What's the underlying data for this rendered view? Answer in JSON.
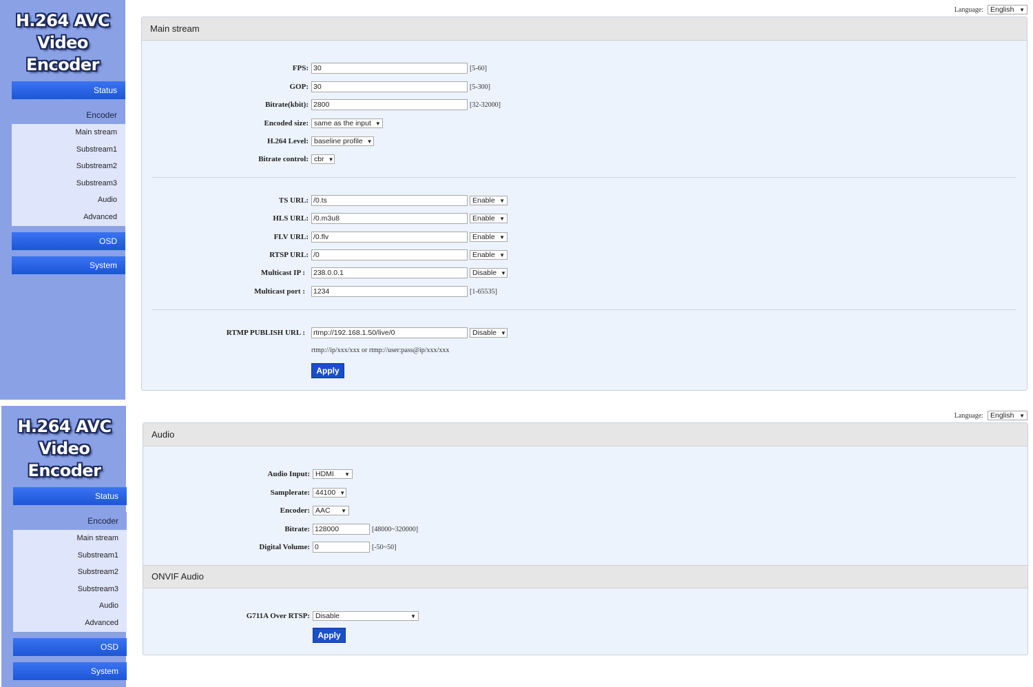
{
  "logo": {
    "line1": "H.264 AVC",
    "line2": "Video Encoder"
  },
  "sidebar": {
    "status": "Status",
    "encoder": "Encoder",
    "items": [
      "Main stream",
      "Substream1",
      "Substream2",
      "Substream3",
      "Audio",
      "Advanced"
    ],
    "osd": "OSD",
    "system": "System"
  },
  "language": {
    "label": "Language:",
    "value": "English"
  },
  "main_stream": {
    "title": "Main stream",
    "fps": {
      "label": "FPS:",
      "value": "30",
      "range": "[5-60]"
    },
    "gop": {
      "label": "GOP:",
      "value": "30",
      "range": "[5-300]"
    },
    "bitrate": {
      "label": "Bitrate(kbit):",
      "value": "2800",
      "range": "[32-32000]"
    },
    "encoded_size": {
      "label": "Encoded size:",
      "value": "same as the input"
    },
    "h264_level": {
      "label": "H.264 Level:",
      "value": "baseline profile"
    },
    "bitrate_control": {
      "label": "Bitrate control:",
      "value": "cbr"
    },
    "ts_url": {
      "label": "TS URL:",
      "value": "/0.ts",
      "state": "Enable"
    },
    "hls_url": {
      "label": "HLS URL:",
      "value": "/0.m3u8",
      "state": "Enable"
    },
    "flv_url": {
      "label": "FLV URL:",
      "value": "/0.flv",
      "state": "Enable"
    },
    "rtsp_url": {
      "label": "RTSP URL:",
      "value": "/0",
      "state": "Enable"
    },
    "multicast_ip": {
      "label": "Multicast IP :",
      "value": "238.0.0.1",
      "state": "Disable"
    },
    "multicast_port": {
      "label": "Multicast port :",
      "value": "1234",
      "range": "[1-65535]"
    },
    "rtmp": {
      "label": "RTMP PUBLISH URL :",
      "value": "rtmp://192.168.1.50/live/0",
      "state": "Disable",
      "hint": "rtmp://ip/xxx/xxx or rtmp://user:pass@ip/xxx/xxx"
    },
    "apply": "Apply"
  },
  "audio": {
    "title": "Audio",
    "audio_input": {
      "label": "Audio Input:",
      "value": "HDMI"
    },
    "samplerate": {
      "label": "Samplerate:",
      "value": "44100"
    },
    "encoder": {
      "label": "Encoder:",
      "value": "AAC"
    },
    "bitrate": {
      "label": "Bitrate:",
      "value": "128000",
      "range": "[48000~320000]"
    },
    "digital_volume": {
      "label": "Digital Volume:",
      "value": "0",
      "range": "[-50~50]"
    },
    "onvif_title": "ONVIF Audio",
    "g711a": {
      "label": "G711A Over RTSP:",
      "value": "Disable"
    },
    "apply": "Apply"
  },
  "colors": {
    "sidebar": "#8aa1e6",
    "nav_button": "#1c56d6",
    "apply_button": "#1a4fc9",
    "panel_bg": "#edf3fc"
  }
}
